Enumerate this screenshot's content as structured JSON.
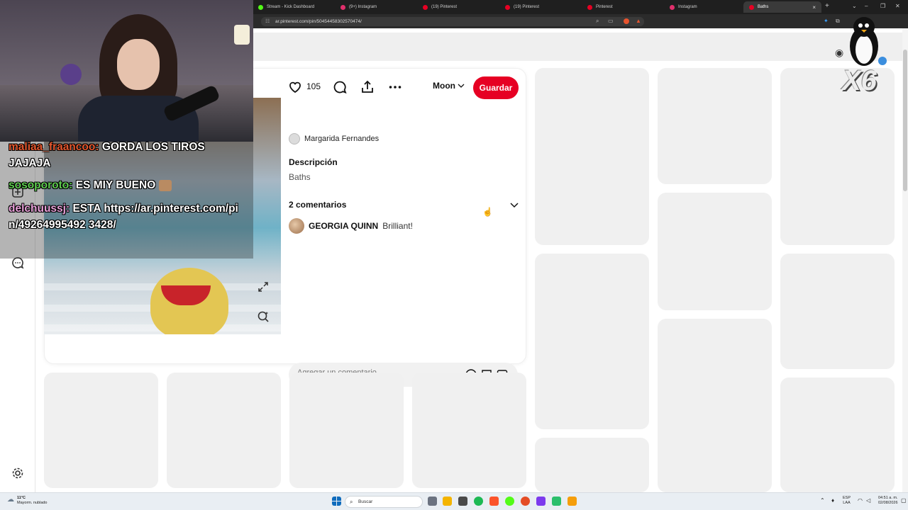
{
  "browser": {
    "tabs": [
      {
        "label": "Stream - Kick Dashboard",
        "color": "#53fc18"
      },
      {
        "label": "(9+) Instagram",
        "color": "#e1306c"
      },
      {
        "label": "(19) Pinterest",
        "color": "#e60023"
      },
      {
        "label": "(19) Pinterest",
        "color": "#e60023"
      },
      {
        "label": "Pinterest",
        "color": "#e60023"
      },
      {
        "label": "Instagram",
        "color": "#e1306c"
      },
      {
        "label": "Baths",
        "color": "#e60023",
        "active": true
      }
    ],
    "new_tab_label": "+",
    "close_label": "×",
    "url": "ar.pinterest.com/pin/50454458302570474/",
    "window_controls": [
      "⌄",
      "–",
      "❐",
      "✕"
    ]
  },
  "pin": {
    "like_count": "105",
    "board_name": "Moon",
    "save_label": "Guardar",
    "author": "Margarida Fernandes",
    "description_title": "Descripción",
    "description_text": "Baths",
    "comments_title": "2 comentarios",
    "comments": [
      {
        "name": "GEORGIA QUINN",
        "text": "Brilliant!"
      }
    ],
    "comment_placeholder": "Agregar un comentario"
  },
  "overlay": {
    "chat": [
      {
        "user": "maliaa_fraancoo:",
        "message": "GORDA LOS TIROS JAJAJA",
        "color": "#e4572e"
      },
      {
        "user": "sosoporoto:",
        "message": "ES MIY BUENO",
        "color": "#5ecb4f"
      },
      {
        "user": "delchuussj:",
        "message": "ESTA https://ar.pinterest.com/pin/49264995492 3428/",
        "color": "#e8a0d8"
      }
    ],
    "multiplier": "X6"
  },
  "taskbar": {
    "weather_temp": "11°C",
    "weather_desc": "Mayorm. nublado",
    "search_label": "Buscar",
    "lang_top": "ESP",
    "lang_bottom": "LAA",
    "time": "04:51 a. m.",
    "date": "02/08/2026"
  },
  "colors": {
    "pinterest_red": "#e60023",
    "placeholder_gray": "#f0f0f0"
  }
}
